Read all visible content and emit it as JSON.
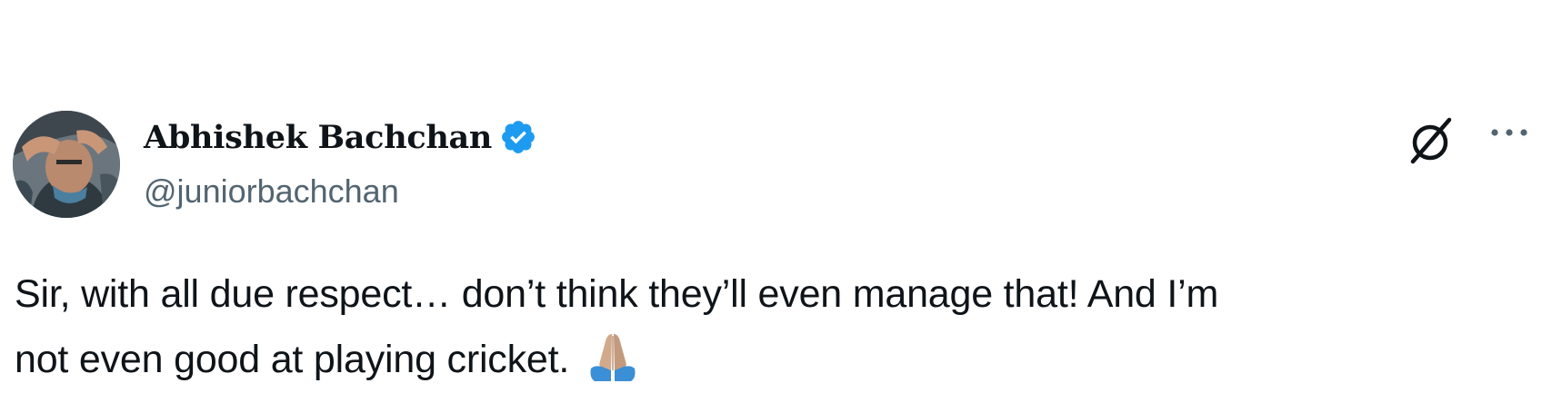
{
  "author": {
    "display_name": "Abhishek Bachchan",
    "handle": "@juniorbachchan",
    "verified": true,
    "verified_badge_color": "#1d9bf0"
  },
  "tweet": {
    "text_line_1": "Sir, with all due respect… don’t think they’ll even manage that! And I’m",
    "text_line_2": "not even good at playing cricket.",
    "emoji": "folded-hands-icon"
  },
  "actions": {
    "grok_icon": "grok-icon",
    "more_icon": "more-options-icon"
  },
  "colors": {
    "text_primary": "#0f1419",
    "text_secondary": "#536471",
    "background": "#ffffff"
  }
}
